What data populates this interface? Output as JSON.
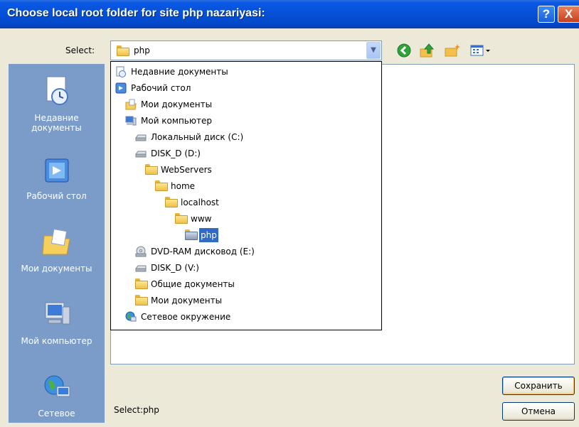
{
  "window": {
    "title": "Choose local root folder for site php nazariyasi:",
    "help_label": "?",
    "close_label": "X"
  },
  "select_row": {
    "label": "Select:",
    "current_value": "php",
    "dropdown_arrow_icon": "chevron-down-icon",
    "toolbar_icons": [
      "back-icon",
      "up-folder-icon",
      "new-folder-icon",
      "view-menu-icon"
    ]
  },
  "places": [
    {
      "label": "Недавние документы",
      "icon": "recent-documents-icon"
    },
    {
      "label": "Рабочий стол",
      "icon": "desktop-icon"
    },
    {
      "label": "Мои документы",
      "icon": "my-documents-icon"
    },
    {
      "label": "Мой компьютер",
      "icon": "my-computer-icon"
    },
    {
      "label": "Сетевое",
      "icon": "network-icon"
    }
  ],
  "dropdown": {
    "items": [
      {
        "label": "Недавние документы",
        "icon": "recent-documents-icon"
      },
      {
        "label": "Рабочий стол",
        "icon": "desktop-icon"
      },
      {
        "label": "Мои документы",
        "icon": "my-documents-icon"
      },
      {
        "label": "Мой компьютер",
        "icon": "computer-icon"
      },
      {
        "label": "Локальный диск (C:)",
        "icon": "hard-drive-icon"
      },
      {
        "label": "DISK_D (D:)",
        "icon": "hard-drive-icon"
      },
      {
        "label": "WebServers",
        "icon": "folder-icon"
      },
      {
        "label": "home",
        "icon": "folder-icon"
      },
      {
        "label": "localhost",
        "icon": "folder-icon"
      },
      {
        "label": "www",
        "icon": "folder-icon"
      },
      {
        "label": "php",
        "icon": "open-folder-icon",
        "selected": true
      },
      {
        "label": "DVD-RAM дисковод (E:)",
        "icon": "dvd-drive-icon"
      },
      {
        "label": "DISK_D (V:)",
        "icon": "hard-drive-icon"
      },
      {
        "label": "Общие документы",
        "icon": "folder-icon"
      },
      {
        "label": "Мои документы",
        "icon": "folder-icon"
      },
      {
        "label": "Сетевое окружение",
        "icon": "network-icon"
      }
    ]
  },
  "footer": {
    "status": "Select:php",
    "save_label": "Сохранить",
    "cancel_label": "Отмена"
  }
}
